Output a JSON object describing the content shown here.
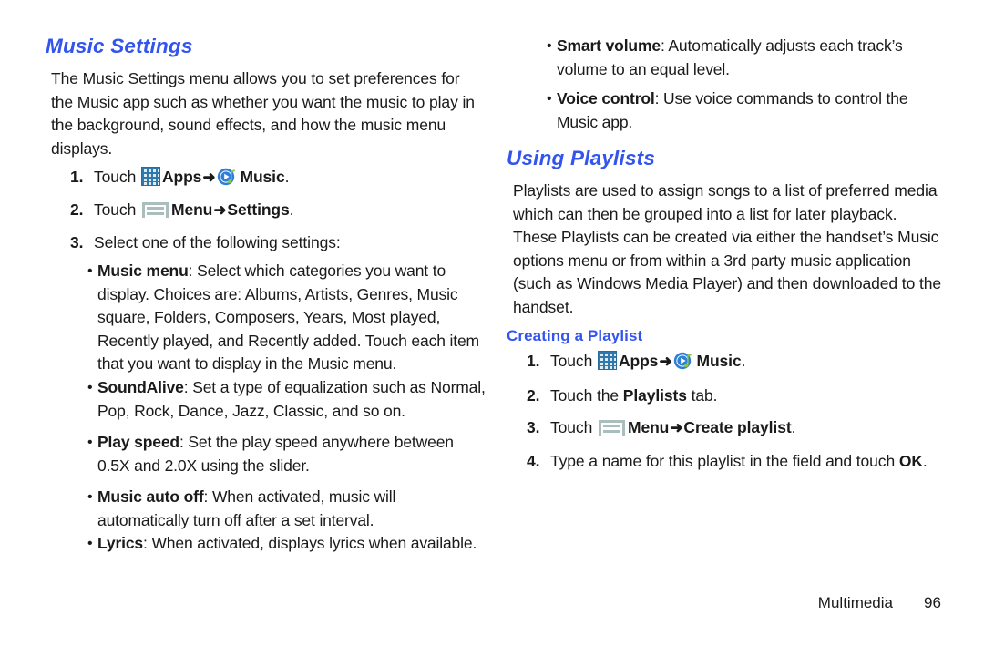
{
  "document": {
    "left_column": {
      "heading": "Music Settings",
      "intro": "The Music Settings menu allows you to set preferences for the Music app such as whether you want the music to play in the background, sound effects, and how the music menu displays.",
      "steps": [
        {
          "num": "1.",
          "pre": "Touch ",
          "icon1": "apps-grid-icon",
          "label1": "Apps",
          "arrow": "➜",
          "icon2": "music-play-icon",
          "label2": "Music",
          "post": "."
        },
        {
          "num": "2.",
          "pre": "Touch ",
          "icon1": "menu-icon",
          "label1": "Menu",
          "arrow": "➜",
          "label2": "Settings",
          "post": "."
        },
        {
          "num": "3.",
          "text": "Select one of the following settings:"
        }
      ],
      "bullets": [
        {
          "dot": "•",
          "term": "Music menu",
          "desc": ": Select which categories you want to display. Choices are: Albums, Artists, Genres, Music square, Folders, Composers, Years, Most played, Recently played, and Recently added. Touch each item that you want to display in the Music menu."
        },
        {
          "dot": "•",
          "term": "SoundAlive",
          "desc": ": Set a type of equalization such as Normal, Pop, Rock, Dance, Jazz, Classic, and so on."
        },
        {
          "dot": "•",
          "term": "Play speed",
          "desc": ": Set the play speed anywhere between 0.5X and 2.0X using the slider."
        },
        {
          "dot": "•",
          "term": "Music auto off",
          "desc": ": When activated, music will automatically turn off after a set interval."
        },
        {
          "dot": "•",
          "term": "Lyrics",
          "desc": ": When activated, displays lyrics when available."
        }
      ]
    },
    "right_column": {
      "bullets": [
        {
          "dot": "•",
          "term": "Smart volume",
          "desc": ": Automatically adjusts each track’s volume to an equal level."
        },
        {
          "dot": "•",
          "term": "Voice control",
          "desc": ": Use voice commands to control the Music app."
        }
      ],
      "heading": "Using Playlists",
      "intro": "Playlists are used to assign songs to a list of preferred media which can then be grouped into a list for later playback. These Playlists can be created via either the handset’s Music options menu or from within a 3rd party music application (such as Windows Media Player) and then downloaded to the handset.",
      "subheading": "Creating a Playlist",
      "steps": [
        {
          "num": "1.",
          "pre": "Touch ",
          "icon1": "apps-grid-icon",
          "label1": "Apps",
          "arrow": "➜",
          "icon2": "music-play-icon",
          "label2": "Music",
          "post": "."
        },
        {
          "num": "2.",
          "pre": "Touch the ",
          "label1": "Playlists",
          "post": " tab."
        },
        {
          "num": "3.",
          "pre": "Touch ",
          "icon1": "menu-icon",
          "label1": "Menu",
          "arrow": "➜",
          "label2": "Create playlist",
          "post": "."
        },
        {
          "num": "4.",
          "pre": "Type a name for this playlist in the field and touch ",
          "label1": "OK",
          "post": "."
        }
      ]
    },
    "footer": {
      "chapter": "Multimedia",
      "page": "96"
    },
    "colors": {
      "heading_blue": "#3355ee",
      "body_text": "#1a1a1a",
      "apps_icon_blue": "#2e7aad",
      "menu_icon_gray": "#aabebd",
      "music_icon_blue": "#2f7fd6",
      "music_icon_green": "#8cc63f"
    }
  }
}
